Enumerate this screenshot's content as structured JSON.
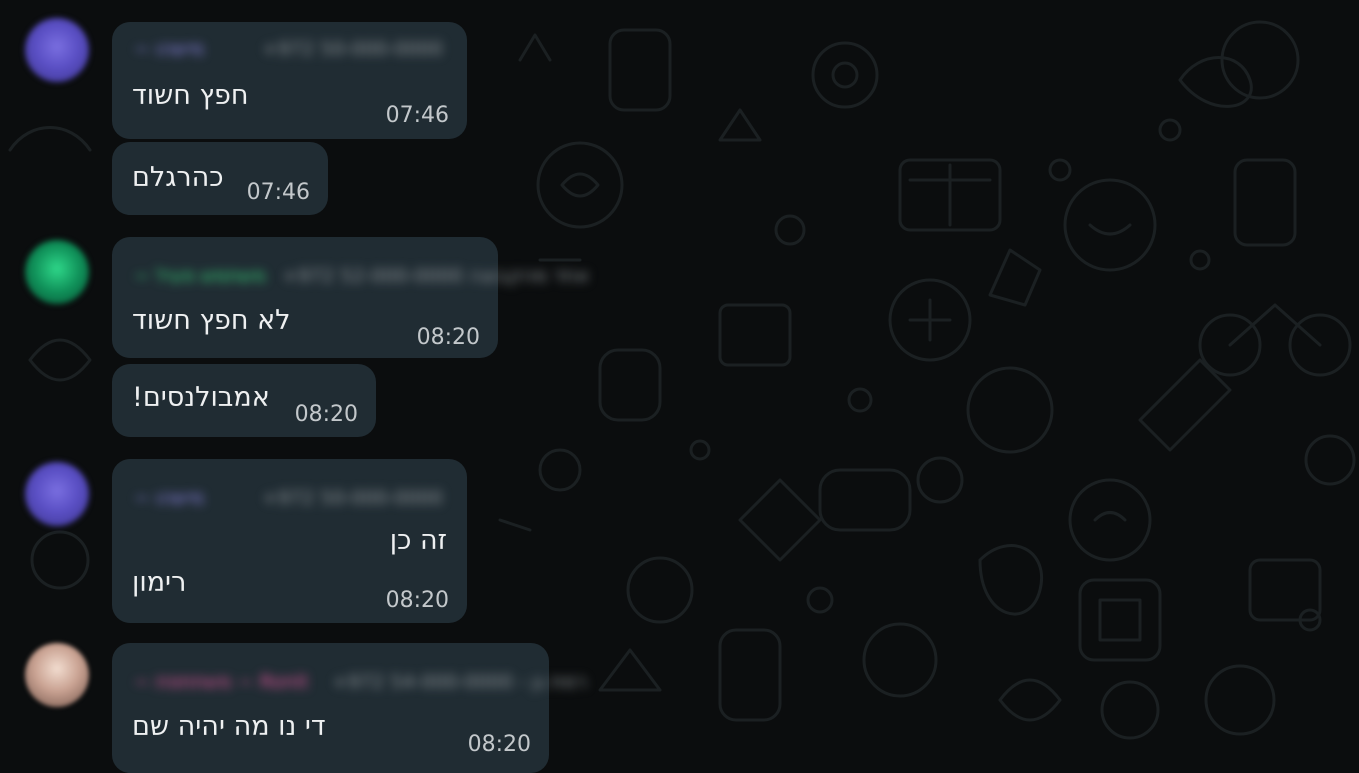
{
  "theme": {
    "background": "#0b0d0e",
    "bubble_incoming": "#202c33",
    "text": "#e9edef",
    "timestamp": "#c3c8cb"
  },
  "messages": [
    {
      "sender_name": "~ מישהו",
      "sender_color": "#8f86e8",
      "sender_extra": "+972 50-000-0000",
      "text": "חפץ חשוד",
      "time": "07:46",
      "avatar": "purple"
    },
    {
      "text": "כהרגלם",
      "time": "07:46"
    },
    {
      "sender_name": "~ משתמש פעיל",
      "sender_color": "#3ad37a",
      "sender_extra": "+972 52-000-0000 אחד מהקבוצה",
      "text": "לא חפץ חשוד",
      "time": "08:20",
      "avatar": "green"
    },
    {
      "text": "אמבולנסים!",
      "time": "08:20"
    },
    {
      "sender_name": "~ מישהו",
      "sender_color": "#8f86e8",
      "sender_extra": "+972 50-000-0000",
      "text_line1": "זה כן",
      "text_line2": "רימון",
      "time": "08:20",
      "avatar": "purple"
    },
    {
      "sender_name": "~ משתתפת ~ Ronit",
      "sender_color": "#e0569a",
      "sender_extra": "+972 54-000-0000 - רמת גן",
      "text": "די נו מה יהיה שם",
      "time": "08:20",
      "avatar": "photo"
    }
  ]
}
